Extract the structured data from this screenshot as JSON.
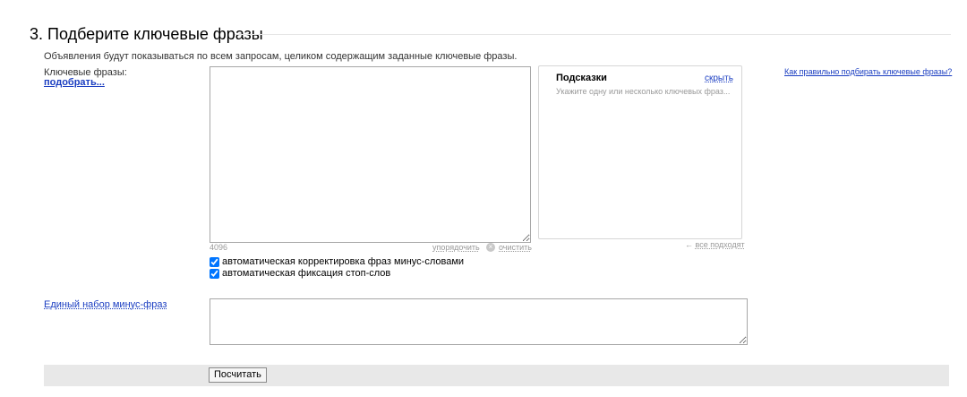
{
  "section": {
    "title": "3. Подберите ключевые фразы",
    "description": "Объявления будут показываться по всем запросам, целиком содержащим заданные ключевые фразы."
  },
  "keywords": {
    "label": "Ключевые фразы:",
    "pick_link": "подобрать...",
    "value": "",
    "counter": "4096",
    "sort_link": "упорядочить",
    "clear_icon": "×",
    "clear_link": "очистить",
    "options": [
      {
        "label": "автоматическая корректировка фраз минус-словами",
        "checked": true
      },
      {
        "label": "автоматическая фиксация стоп-слов",
        "checked": true
      }
    ]
  },
  "hints": {
    "title": "Подсказки",
    "hide_link": "скрыть",
    "placeholder": "Укажите одну или несколько ключевых фраз...",
    "arrow": "←",
    "all_fit_link": "все подходят"
  },
  "help_link": "Как правильно подбирать ключевые фразы?",
  "minus_phrases": {
    "label": "Единый набор минус-фраз",
    "value": ""
  },
  "actions": {
    "calculate_label": "Посчитать"
  }
}
